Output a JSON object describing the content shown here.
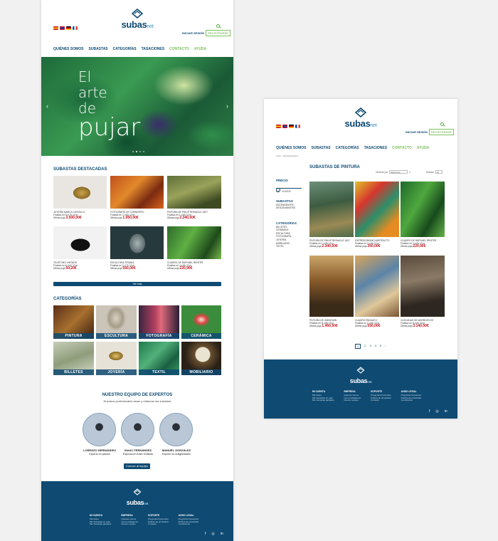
{
  "brand": {
    "name": "subas",
    "suffix": "net"
  },
  "header": {
    "login": "INICIAR SESIÓN",
    "register": "REGISTRARSE"
  },
  "nav": [
    "QUIÉNES SOMOS",
    "SUBASTAS",
    "CATEGORÍAS",
    "TASACIONES",
    "CONTACTO",
    "AYUDA"
  ],
  "hero": {
    "line1": "El",
    "line2": "arte",
    "line3": "de",
    "line4": "pujar"
  },
  "featured": {
    "title": "SUBASTAS DESTACADAS",
    "items": [
      {
        "name": "JOYERÍA MARCA CUROM L0",
        "ends": "Finaliza en 6 d 7h 10 m",
        "bid_label": "Última puja",
        "price": "3.500,00€"
      },
      {
        "name": "FOTOGRAFÍA DE CORNIFERO",
        "ends": "Finaliza en 7 d 6h 10 m",
        "bid_label": "Última puja",
        "price": "1.050,00€"
      },
      {
        "name": "PINTURA DE PHILIP REINAGLE 1807",
        "ends": "Finaliza en 1 d 6h 10 m",
        "bid_label": "Última puja",
        "price": "2.340,50€"
      },
      {
        "name": "TELÉFONO VINTAGE",
        "ends": "Finaliza en 6 d 6h 10 m",
        "bid_label": "Última puja",
        "price": "50,20€"
      },
      {
        "name": "ESCULTURA TIRANIA",
        "ends": "Finaliza en 2 d 7h 10 m",
        "bid_label": "Última puja",
        "price": "550,00€"
      },
      {
        "name": "CUADRO DE RAPHAEL RENTER",
        "ends": "Finaliza en 4 d 6h 10 m",
        "bid_label": "Última puja",
        "price": "220,90€"
      }
    ],
    "more": "Ver más"
  },
  "categories": {
    "title": "CATEGORÍAS",
    "items": [
      "PINTURA",
      "ESCULTURA",
      "FOTOGRAFÍA",
      "CERÁMICA",
      "BILLETES",
      "JOYERÍA",
      "TEXTIL",
      "MOBILIARIO"
    ]
  },
  "experts": {
    "title": "NUESTRO EQUIPO DE EXPERTOS",
    "subtitle": "Nuestros profesionales tasan y elaboran las subastas",
    "people": [
      {
        "name": "LORENZO HERNÁNDEZ",
        "role": "Experto en pintura"
      },
      {
        "name": "ISAAC FERNÁNDEZ",
        "role": "Especial en Artes Gráficas"
      },
      {
        "name": "MANUEL GONZÁLEZ",
        "role": "Experto en Antigüedades"
      }
    ],
    "button": "Conoce al equipo"
  },
  "footer": {
    "cols": [
      {
        "title": "MI CUENTA",
        "links": [
          "Mis datos",
          "Mis Subastas en puja",
          "Mis Subastas ganadas"
        ]
      },
      {
        "title": "EMPRESA",
        "links": [
          "Quiénes somos",
          "Cómo trabajamos",
          "Nuestro equipo"
        ]
      },
      {
        "title": "SOPORTE",
        "links": [
          "Preguntas frecuentes",
          "Política de privacidad",
          "Contacto"
        ]
      },
      {
        "title": "AVISO LEGAL",
        "links": [
          "Preguntas frecuentes",
          "Política de privacidad",
          "Condiciones"
        ]
      }
    ],
    "social": [
      "f",
      "◎",
      "in"
    ]
  },
  "listing": {
    "breadcrumb": "Inicio > Subastas/pintura",
    "title": "SUBASTAS DE PINTURA",
    "order_label": "Ordenar por",
    "order_value": "Seleccione",
    "show_label": "Mostrar",
    "show_value": "12",
    "filters": {
      "price_title": "PRECIO",
      "price_min": "0 €",
      "price_max": "10.000 €",
      "auctions_title": "SUBASTAS",
      "auctions": [
        "ASCENDENTES",
        "DESCENDENTES"
      ],
      "cats_title": "CATEGORÍAS",
      "cats": [
        "BILLETES",
        "CERÁMICA",
        "ESCULTURA",
        "FOTOGRAFÍA",
        "JOYERÍA",
        "MOBILIARIO",
        "TEXTIL"
      ]
    },
    "items": [
      {
        "name": "PINTURA DE PHILIP REINAGLE 1807",
        "ends": "Finaliza en 1 d 6h 10 m",
        "bid_label": "Última puja",
        "price": "2.340,50€"
      },
      {
        "name": "EXPRESIONISMO ABSTRACTO",
        "ends": "Finaliza en 3 d 6h 10 m",
        "bid_label": "Última puja",
        "price": "350,00€"
      },
      {
        "name": "CUADRO DE RAPHAEL RENTER",
        "ends": "Finaliza en 4 d 6h 10 m",
        "bid_label": "Última puja",
        "price": "220,90€"
      },
      {
        "name": "PINTURA DE UNKNOWN",
        "ends": "Finaliza en 5 d 6h 10 m",
        "bid_label": "Última puja",
        "price": "1.450,50€"
      },
      {
        "name": "CUADRO PAISAJE II",
        "ends": "Finaliza en 2 d 6h 10 m",
        "bid_label": "Última puja",
        "price": "550,00€"
      },
      {
        "name": "CASCADAS DE MARRUECOS",
        "ends": "Finaliza en 6 d 6h 10 m",
        "bid_label": "Última puja",
        "price": "3.140,50€"
      }
    ],
    "pages": [
      "1",
      "2",
      "3",
      "4",
      "5",
      "›"
    ]
  }
}
